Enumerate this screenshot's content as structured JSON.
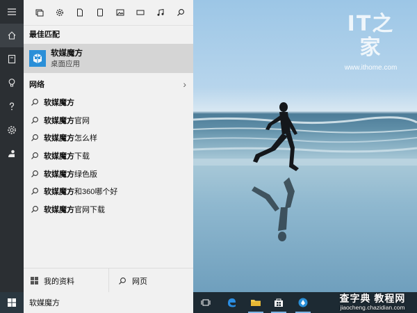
{
  "rail": {
    "items": [
      {
        "icon": "hamburger-menu-icon"
      },
      {
        "icon": "home-icon"
      },
      {
        "icon": "notebook-icon"
      },
      {
        "icon": "lightbulb-icon"
      },
      {
        "icon": "help-icon"
      },
      {
        "icon": "settings-icon"
      },
      {
        "icon": "feedback-icon"
      }
    ]
  },
  "filters": [
    "apps-icon",
    "settings-icon",
    "documents-icon",
    "tablet-icon",
    "photos-icon",
    "videos-icon",
    "music-icon",
    "search-icon"
  ],
  "best_match": {
    "header": "最佳匹配",
    "title": "软媒魔方",
    "subtitle": "桌面应用"
  },
  "web": {
    "header": "网络",
    "suggestions": [
      {
        "bold": "软媒魔方",
        "rest": ""
      },
      {
        "bold": "软媒魔方",
        "rest": "官网"
      },
      {
        "bold": "软媒魔方",
        "rest": "怎么样"
      },
      {
        "bold": "软媒魔方",
        "rest": "下载"
      },
      {
        "bold": "软媒魔方",
        "rest": "绿色版"
      },
      {
        "bold": "软媒魔方",
        "rest": "和360哪个好"
      },
      {
        "bold": "软媒魔方",
        "rest": "官网下载"
      }
    ]
  },
  "bottom": {
    "my_stuff": "我的资料",
    "web": "网页"
  },
  "taskbar": {
    "search_value": "软媒魔方",
    "icons": [
      "task-view-icon",
      "edge-icon",
      "file-explorer-icon",
      "store-icon",
      "app-icon"
    ]
  },
  "watermark": {
    "logo": "IT之家",
    "url": "www.ithome.com"
  },
  "site_mark": {
    "title": "查字典 教程网",
    "url": "jiaocheng.chazidian.com"
  },
  "colors": {
    "rail_bg": "#2b2f33",
    "panel_bg": "#f1f1f1",
    "highlight_bg": "#d5d5d5",
    "accent": "#2a8fd8",
    "taskbar_bg": "#1d2a33"
  }
}
